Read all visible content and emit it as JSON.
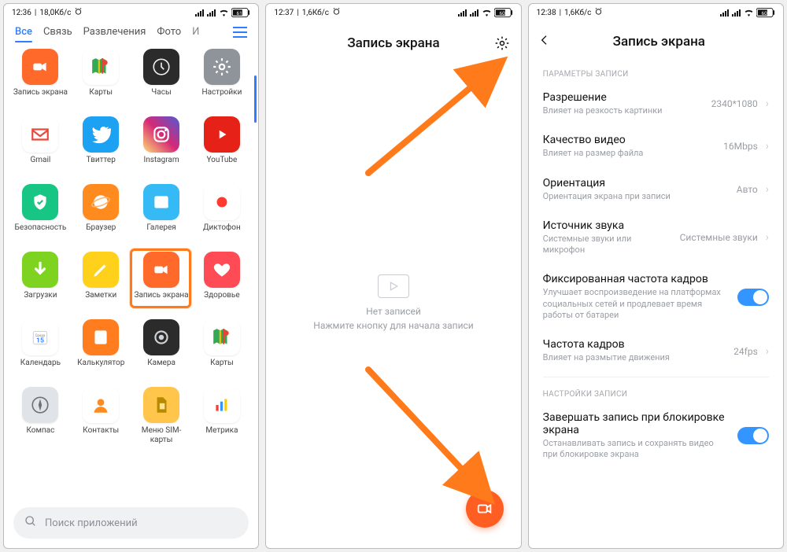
{
  "screen1": {
    "status": {
      "time": "12:36",
      "net": "18,0Кб/с",
      "alarm": true,
      "battery": "61"
    },
    "tabs": [
      "Все",
      "Связь",
      "Развлечения",
      "Фото",
      "И"
    ],
    "active_tab": 0,
    "apps": [
      {
        "name": "Запись экрана",
        "key": "screenrec"
      },
      {
        "name": "Карты",
        "key": "gmaps"
      },
      {
        "name": "Часы",
        "key": "clock"
      },
      {
        "name": "Настройки",
        "key": "settings"
      },
      {
        "name": "Gmail",
        "key": "gmail"
      },
      {
        "name": "Твиттер",
        "key": "twitter"
      },
      {
        "name": "Instagram",
        "key": "instagram"
      },
      {
        "name": "YouTube",
        "key": "youtube"
      },
      {
        "name": "Безопасность",
        "key": "security"
      },
      {
        "name": "Браузер",
        "key": "browser"
      },
      {
        "name": "Галерея",
        "key": "gallery"
      },
      {
        "name": "Диктофон",
        "key": "recorder"
      },
      {
        "name": "Загрузки",
        "key": "downloads"
      },
      {
        "name": "Заметки",
        "key": "notes"
      },
      {
        "name": "Запись экрана",
        "key": "screenrec"
      },
      {
        "name": "Здоровье",
        "key": "health"
      },
      {
        "name": "Календарь",
        "key": "calendar",
        "badge": "Среда",
        "badge_num": "15"
      },
      {
        "name": "Калькулятор",
        "key": "calculator"
      },
      {
        "name": "Камера",
        "key": "camera"
      },
      {
        "name": "Карты",
        "key": "gmaps"
      },
      {
        "name": "Компас",
        "key": "compass"
      },
      {
        "name": "Контакты",
        "key": "contacts"
      },
      {
        "name": "Меню SIM-карты",
        "key": "sim"
      },
      {
        "name": "Метрика",
        "key": "metrika"
      }
    ],
    "highlight_index": 14,
    "search_placeholder": "Поиск приложений"
  },
  "screen2": {
    "status": {
      "time": "12:37",
      "net": "1,6Кб/с",
      "alarm": true,
      "battery": "60"
    },
    "title": "Запись экрана",
    "empty_title": "Нет записей",
    "empty_sub": "Нажмите кнопку для начала записи"
  },
  "screen3": {
    "status": {
      "time": "12:38",
      "net": "1,6Кб/с",
      "alarm": true,
      "battery": "60"
    },
    "title": "Запись экрана",
    "section1": "ПАРАМЕТРЫ ЗАПИСИ",
    "rows1": [
      {
        "title": "Разрешение",
        "sub": "Влияет на резкость картинки",
        "value": "2340*1080",
        "type": "nav"
      },
      {
        "title": "Качество видео",
        "sub": "Влияет на размер файла",
        "value": "16Mbps",
        "type": "nav"
      },
      {
        "title": "Ориентация",
        "sub": "Ориентация экрана при записи",
        "value": "Авто",
        "type": "nav"
      },
      {
        "title": "Источник звука",
        "sub": "Системные звуки или микрофон",
        "value": "Системные звуки",
        "type": "nav"
      },
      {
        "title": "Фиксированная частота кадров",
        "sub": "Улучшает воспроизведение на платформах социальных сетей и продлевает время работы от батареи",
        "value": "",
        "type": "toggle",
        "on": true
      },
      {
        "title": "Частота кадров",
        "sub": "Влияет на размытие движения",
        "value": "24fps",
        "type": "nav"
      }
    ],
    "section2": "НАСТРОЙКИ ЗАПИСИ",
    "rows2": [
      {
        "title": "Завершать запись при блокировке экрана",
        "sub": "Останавливать запись и сохранять видео при блокировке экрана",
        "value": "",
        "type": "toggle",
        "on": true
      }
    ]
  },
  "icon_styles": {
    "screenrec": {
      "bg": "#ff6a2b",
      "fg": "#fff",
      "glyph": "video"
    },
    "gmaps": {
      "bg": "#ffffff",
      "fg": "#4285f4",
      "glyph": "gmaps"
    },
    "clock": {
      "bg": "#2b2b2b",
      "fg": "#eeeeee",
      "glyph": "clock"
    },
    "settings": {
      "bg": "#8f949b",
      "fg": "#fff",
      "glyph": "gear"
    },
    "gmail": {
      "bg": "#ffffff",
      "fg": "#e64a3b",
      "glyph": "mail"
    },
    "twitter": {
      "bg": "#1da1f2",
      "fg": "#fff",
      "glyph": "bird"
    },
    "instagram": {
      "bg": "linear-gradient(45deg,#feda75,#d62976,#4f5bd5)",
      "fg": "#fff",
      "glyph": "cam"
    },
    "youtube": {
      "bg": "#e62117",
      "fg": "#fff",
      "glyph": "play"
    },
    "security": {
      "bg": "#17c684",
      "fg": "#fff",
      "glyph": "shield"
    },
    "browser": {
      "bg": "#ff8a1e",
      "fg": "#fff",
      "glyph": "planet"
    },
    "gallery": {
      "bg": "#35baf6",
      "fg": "#fff",
      "glyph": "image"
    },
    "recorder": {
      "bg": "#ffffff",
      "fg": "#ff3b30",
      "glyph": "dot"
    },
    "downloads": {
      "bg": "#7ed321",
      "fg": "#fff",
      "glyph": "down"
    },
    "notes": {
      "bg": "#ffd11a",
      "fg": "#fff",
      "glyph": "pencil"
    },
    "health": {
      "bg": "#ff4b55",
      "fg": "#fff",
      "glyph": "heart"
    },
    "calendar": {
      "bg": "#ffffff",
      "fg": "#2f7dff",
      "glyph": "cal"
    },
    "calculator": {
      "bg": "#ff7d1e",
      "fg": "#fff",
      "glyph": "calc"
    },
    "camera": {
      "bg": "#2b2b2b",
      "fg": "#cfd3d8",
      "glyph": "lens"
    },
    "compass": {
      "bg": "#e0e3e7",
      "fg": "#6d7176",
      "glyph": "compass"
    },
    "contacts": {
      "bg": "#ffffff",
      "fg": "#ff8a1e",
      "glyph": "person"
    },
    "sim": {
      "bg": "#ffc64b",
      "fg": "#b78900",
      "glyph": "sim"
    },
    "metrika": {
      "bg": "#ffffff",
      "fg": "#ff3b30",
      "glyph": "bars"
    }
  }
}
